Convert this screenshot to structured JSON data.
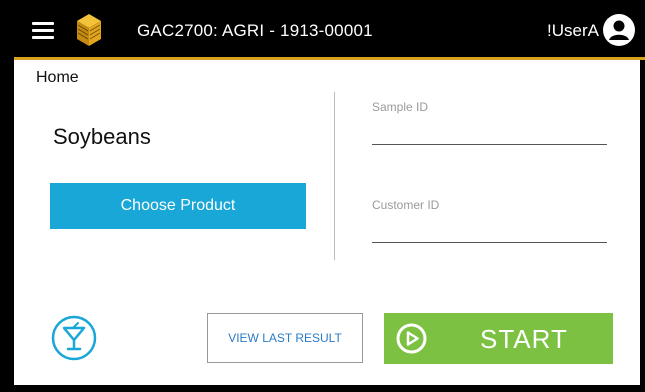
{
  "header": {
    "title": "GAC2700: AGRI - 1913-00001",
    "username": "!UserA",
    "icons": {
      "menu": "hamburger-menu-icon",
      "logo": "cube-logo-icon",
      "user": "user-account-icon"
    }
  },
  "breadcrumb": "Home",
  "product": {
    "name": "Soybeans",
    "choose_label": "Choose Product"
  },
  "fields": {
    "sample_id": {
      "label": "Sample ID",
      "value": ""
    },
    "customer_id": {
      "label": "Customer ID",
      "value": ""
    }
  },
  "actions": {
    "view_last_result_label": "VIEW LAST RESULT",
    "start_label": "START"
  },
  "colors": {
    "header_bg": "#000000",
    "accent_gold": "#d9a21f",
    "choose_button": "#18a7d6",
    "start_button": "#7cc142",
    "link_blue": "#2a7cc7"
  }
}
